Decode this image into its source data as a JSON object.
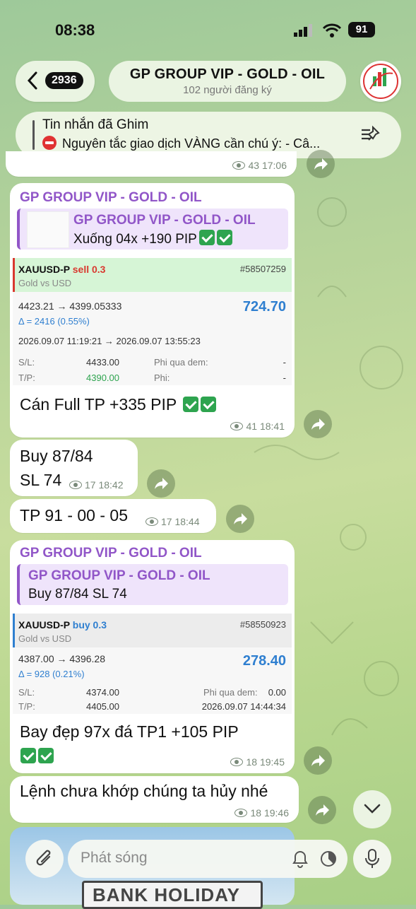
{
  "status": {
    "time": "08:38",
    "battery": "91"
  },
  "header": {
    "back_count": "2936",
    "title": "GP GROUP VIP - GOLD - OIL",
    "subtitle": "102 người đăng ký"
  },
  "pinned": {
    "title": "Tin nhắn đã Ghim",
    "text": "Nguyên tắc giao dịch VÀNG cần chú ý: - Câ..."
  },
  "top_meta": {
    "views": "43",
    "time": "17:06"
  },
  "messages": {
    "m1": {
      "sender": "GP GROUP VIP - GOLD - OIL",
      "quote_title": "GP GROUP VIP - GOLD - OIL",
      "quote_text": "Xuống 04x +190 PIP",
      "card": {
        "symbol": "XAUUSD-P",
        "side": "sell 0.3",
        "id": "#58507259",
        "desc": "Gold vs USD",
        "prices": "4423.21 → 4399.05333",
        "profit": "724.70",
        "delta": "Δ = 2416 (0.55%)",
        "times": "2026.09.07 11:19:21 → 2026.09.07 13:55:23",
        "sl_label": "S/L:",
        "sl": "4433.00",
        "tp_label": "T/P:",
        "tp": "4390.00",
        "fee1_label": "Phi qua dem:",
        "fee1": "-",
        "fee2_label": "Phi:",
        "fee2": "-"
      },
      "text": "Cán Full TP +335 PIP",
      "views": "41",
      "time": "18:41"
    },
    "m2": {
      "line1": "Buy 87/84",
      "line2": "SL 74",
      "meta": "17 18:42"
    },
    "m3": {
      "text": "TP 91 - 00 - 05",
      "meta": "17 18:44"
    },
    "m4": {
      "sender": "GP GROUP VIP - GOLD - OIL",
      "quote_title": "GP GROUP VIP - GOLD - OIL",
      "quote_text": "Buy 87/84 SL 74",
      "card": {
        "symbol": "XAUUSD-P",
        "side": "buy 0.3",
        "id": "#58550923",
        "desc": "Gold vs USD",
        "prices": "4387.00 → 4396.28",
        "profit": "278.40",
        "delta": "Δ = 928 (0.21%)",
        "sl_label": "S/L:",
        "sl": "4374.00",
        "tp_label": "T/P:",
        "tp": "4405.00",
        "fee1_label": "Phi qua dem:",
        "fee1": "0.00",
        "date": "2026.09.07 14:44:34"
      },
      "text": "Bay đẹp 97x đá TP1 +105 PIP",
      "views": "18",
      "time": "19:45"
    },
    "m5": {
      "text": "Lệnh chưa khớp chúng ta hủy nhé",
      "views": "18",
      "time": "19:46"
    }
  },
  "photo_preview": {
    "sign_text": "BANK HOLIDAY"
  },
  "composer": {
    "placeholder": "Phát sóng"
  },
  "icons": {
    "back": "chevron-left-icon",
    "pin": "pin-list-icon",
    "share": "share-arrow-icon",
    "eye": "eye-icon",
    "attach": "paperclip-icon",
    "bell": "bell-icon",
    "timer": "timer-icon",
    "mic": "microphone-icon",
    "down": "chevron-down-icon"
  },
  "colors": {
    "accent": "#9156c8",
    "profit": "#2f7fd0",
    "sell": "#d9382f",
    "buy": "#2f7fd0",
    "check": "#2ea44f"
  }
}
